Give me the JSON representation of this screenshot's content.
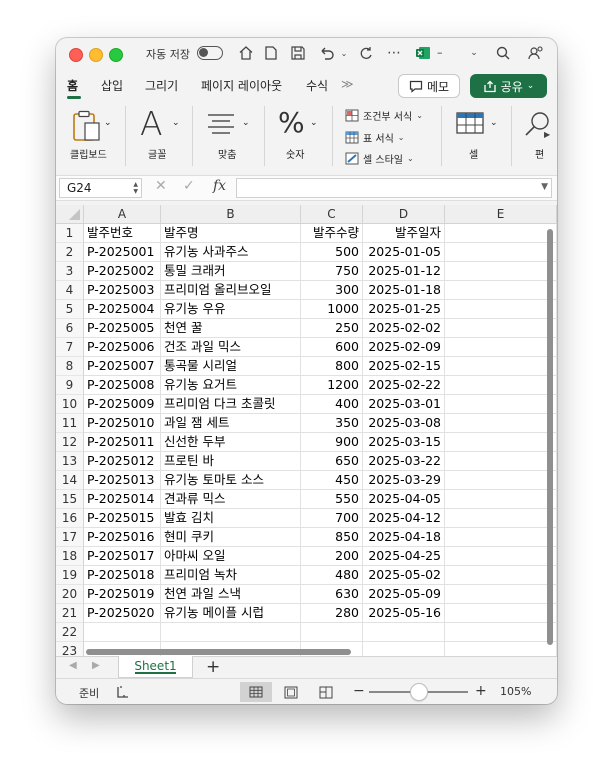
{
  "titlebar": {
    "autosave_label": "자동 저장",
    "doc_title": "–"
  },
  "tabs": [
    "홈",
    "삽입",
    "그리기",
    "페이지 레이아웃",
    "수식"
  ],
  "tabs_more": "≫",
  "memo_label": "메모",
  "share_label": "공유",
  "ribbon": {
    "clipboard": "클립보드",
    "font": "글꼴",
    "align": "맞춤",
    "number": "숫자",
    "conditional": "조건부 서식",
    "table_format": "표 서식",
    "cell_style": "셀 스타일",
    "cells": "셀",
    "editing": "편"
  },
  "formula_bar": {
    "name_box": "G24",
    "cancel": "✕",
    "enter": "✓",
    "fx": "fx",
    "formula": ""
  },
  "sheet": {
    "columns": [
      "A",
      "B",
      "C",
      "D",
      "E"
    ],
    "rows": [
      {
        "num": "1",
        "a": "발주번호",
        "b": "발주명",
        "c": "발주수량",
        "d": "발주일자"
      },
      {
        "num": "2",
        "a": "P-2025001",
        "b": "유기농 사과주스",
        "c": "500",
        "d": "2025-01-05"
      },
      {
        "num": "3",
        "a": "P-2025002",
        "b": "통밀 크래커",
        "c": "750",
        "d": "2025-01-12"
      },
      {
        "num": "4",
        "a": "P-2025003",
        "b": "프리미엄 올리브오일",
        "c": "300",
        "d": "2025-01-18"
      },
      {
        "num": "5",
        "a": "P-2025004",
        "b": "유기농 우유",
        "c": "1000",
        "d": "2025-01-25"
      },
      {
        "num": "6",
        "a": "P-2025005",
        "b": "천연 꿀",
        "c": "250",
        "d": "2025-02-02"
      },
      {
        "num": "7",
        "a": "P-2025006",
        "b": "건조 과일 믹스",
        "c": "600",
        "d": "2025-02-09"
      },
      {
        "num": "8",
        "a": "P-2025007",
        "b": "통곡물 시리얼",
        "c": "800",
        "d": "2025-02-15"
      },
      {
        "num": "9",
        "a": "P-2025008",
        "b": "유기농 요거트",
        "c": "1200",
        "d": "2025-02-22"
      },
      {
        "num": "10",
        "a": "P-2025009",
        "b": "프리미엄 다크 초콜릿",
        "c": "400",
        "d": "2025-03-01"
      },
      {
        "num": "11",
        "a": "P-2025010",
        "b": "과일 잼 세트",
        "c": "350",
        "d": "2025-03-08"
      },
      {
        "num": "12",
        "a": "P-2025011",
        "b": "신선한 두부",
        "c": "900",
        "d": "2025-03-15"
      },
      {
        "num": "13",
        "a": "P-2025012",
        "b": "프로틴 바",
        "c": "650",
        "d": "2025-03-22"
      },
      {
        "num": "14",
        "a": "P-2025013",
        "b": "유기농 토마토 소스",
        "c": "450",
        "d": "2025-03-29"
      },
      {
        "num": "15",
        "a": "P-2025014",
        "b": "견과류 믹스",
        "c": "550",
        "d": "2025-04-05"
      },
      {
        "num": "16",
        "a": "P-2025015",
        "b": "발효 김치",
        "c": "700",
        "d": "2025-04-12"
      },
      {
        "num": "17",
        "a": "P-2025016",
        "b": "현미 쿠키",
        "c": "850",
        "d": "2025-04-18"
      },
      {
        "num": "18",
        "a": "P-2025017",
        "b": "아마씨 오일",
        "c": "200",
        "d": "2025-04-25"
      },
      {
        "num": "19",
        "a": "P-2025018",
        "b": "프리미엄 녹차",
        "c": "480",
        "d": "2025-05-02"
      },
      {
        "num": "20",
        "a": "P-2025019",
        "b": "천연 과일 스낵",
        "c": "630",
        "d": "2025-05-09"
      },
      {
        "num": "21",
        "a": "P-2025020",
        "b": "유기농 메이플 시럽",
        "c": "280",
        "d": "2025-05-16"
      },
      {
        "num": "22",
        "a": "",
        "b": "",
        "c": "",
        "d": ""
      },
      {
        "num": "23",
        "a": "",
        "b": "",
        "c": "",
        "d": ""
      }
    ]
  },
  "sheet_tabs": [
    "Sheet1"
  ],
  "add_sheet": "+",
  "status": {
    "ready": "준비",
    "zoom_minus": "−",
    "zoom_plus": "+",
    "zoom": "105%"
  },
  "colors": {
    "accent": "#1e7145",
    "excel_icon": "#1d6f42"
  }
}
